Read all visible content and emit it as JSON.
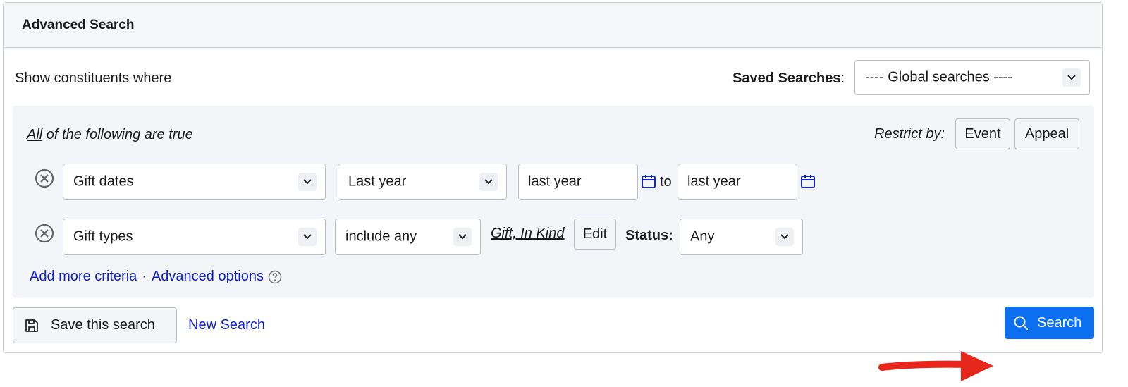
{
  "panel": {
    "title": "Advanced Search"
  },
  "intro": {
    "show_text": "Show constituents where"
  },
  "saved_searches": {
    "label": "Saved Searches",
    "colon": ":",
    "selected": "---- Global searches ----"
  },
  "criteria": {
    "all_word": "All",
    "all_rest": " of the following are true",
    "restrict_label": "Restrict by:",
    "restrict_buttons": [
      "Event",
      "Appeal"
    ],
    "row1": {
      "field": "Gift dates",
      "operator": "Last year",
      "from_value": "last year",
      "to_text": "to",
      "to_value": "last year"
    },
    "row2": {
      "field": "Gift types",
      "operator": "include any",
      "value_link": "Gift, In Kind",
      "edit_label": "Edit",
      "status_label": "Status:",
      "status_value": "Any"
    },
    "add_more": "Add more criteria",
    "separator": "·",
    "advanced_options": "Advanced options"
  },
  "footer": {
    "save_label": "Save this search",
    "new_search": "New Search",
    "search_label": "Search"
  },
  "colors": {
    "accent": "#0b6ff0",
    "link": "#1024c8",
    "annotation_arrow": "#e5271c"
  }
}
